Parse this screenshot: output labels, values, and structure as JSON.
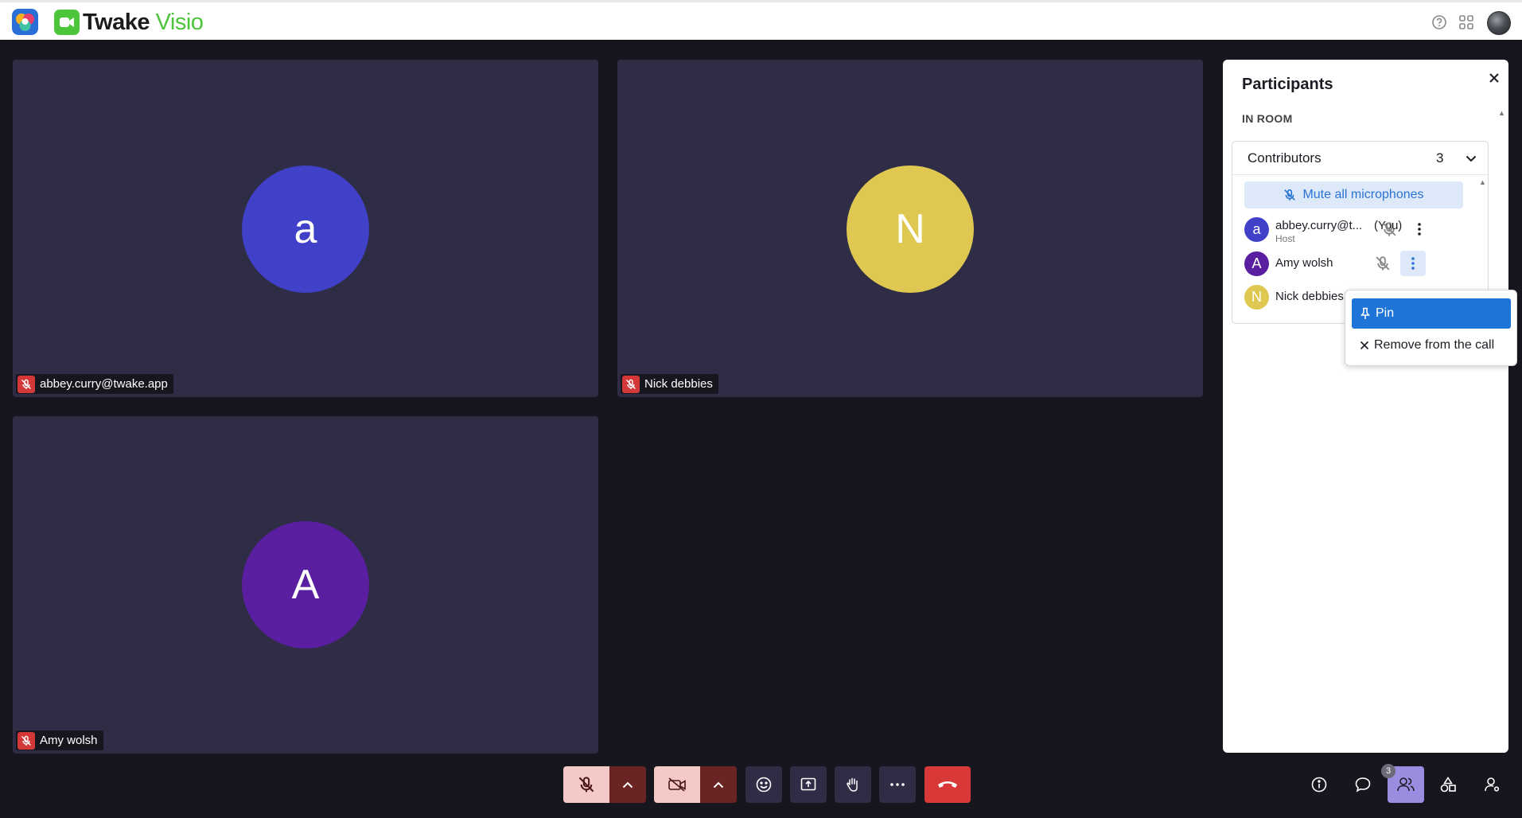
{
  "header": {
    "brand_main": "Twake",
    "brand_accent": "Visio",
    "icons": [
      "help-icon",
      "apps-grid-icon",
      "user-avatar"
    ]
  },
  "tiles": [
    {
      "initial": "a",
      "name": "abbey.curry@twake.app",
      "color": "#4040c8"
    },
    {
      "initial": "N",
      "name": "Nick debbies",
      "color": "#dfc851"
    },
    {
      "initial": "A",
      "name": "Amy wolsh",
      "color": "#5a1fa0"
    }
  ],
  "participants": {
    "title": "Participants",
    "section": "IN ROOM",
    "group_label": "Contributors",
    "group_count": "3",
    "mute_all_label": "Mute all microphones",
    "list": [
      {
        "initial": "a",
        "name": "abbey.curry@t...",
        "tag": "(You)",
        "role": "Host",
        "color": "#4040c8"
      },
      {
        "initial": "A",
        "name": "Amy wolsh",
        "tag": "",
        "role": "",
        "color": "#5a1fa0"
      },
      {
        "initial": "N",
        "name": "Nick debbies",
        "tag": "",
        "role": "",
        "color": "#dfc851"
      }
    ]
  },
  "context_menu": {
    "pin_label": "Pin",
    "remove_label": "Remove from the call"
  },
  "toolbar": {
    "participants_badge": "3"
  },
  "colors": {
    "background": "#16161f",
    "tile": "#2e2d45",
    "accent_green": "#4cc53a",
    "hangup_red": "#d93838",
    "menu_blue": "#1f74d8"
  }
}
